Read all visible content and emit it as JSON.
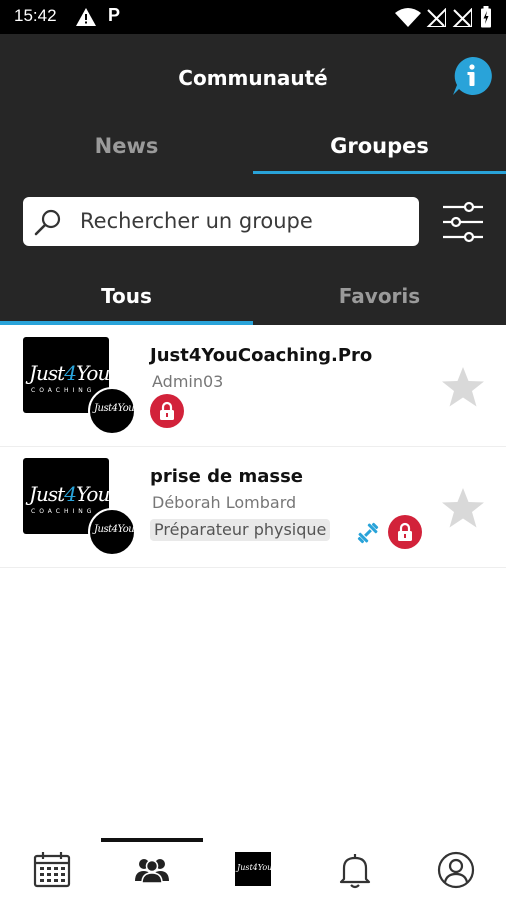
{
  "status_bar": {
    "time": "15:42",
    "warning_icon": "warning-icon",
    "parking_icon": "P"
  },
  "header": {
    "title": "Communauté",
    "info_icon": "info-icon"
  },
  "tabs": [
    {
      "label": "News"
    },
    {
      "label": "Groupes"
    }
  ],
  "search": {
    "placeholder": "Rechercher un groupe"
  },
  "subtabs": [
    {
      "label": "Tous"
    },
    {
      "label": "Favoris"
    }
  ],
  "groups": [
    {
      "name": "Just4YouCoaching.Pro",
      "admin": "Admin03",
      "locked": true,
      "favorite": false
    },
    {
      "name": "prise de masse",
      "admin": "Déborah Lombard",
      "tag": "Préparateur physique",
      "locked": true,
      "favorite": false
    }
  ],
  "logo": {
    "text_a": "Just",
    "text_b": "4",
    "text_c": "You",
    "subtext": "COACHING",
    "circle_text": "Just4You"
  },
  "bottom_nav": [
    "calendar-icon",
    "groups-icon",
    "club-logo",
    "bell-icon",
    "profile-icon"
  ],
  "colors": {
    "accent": "#29a3d9",
    "header_bg": "#262626",
    "lock_red": "#d2223a",
    "star_grey": "#d9d9d9"
  }
}
